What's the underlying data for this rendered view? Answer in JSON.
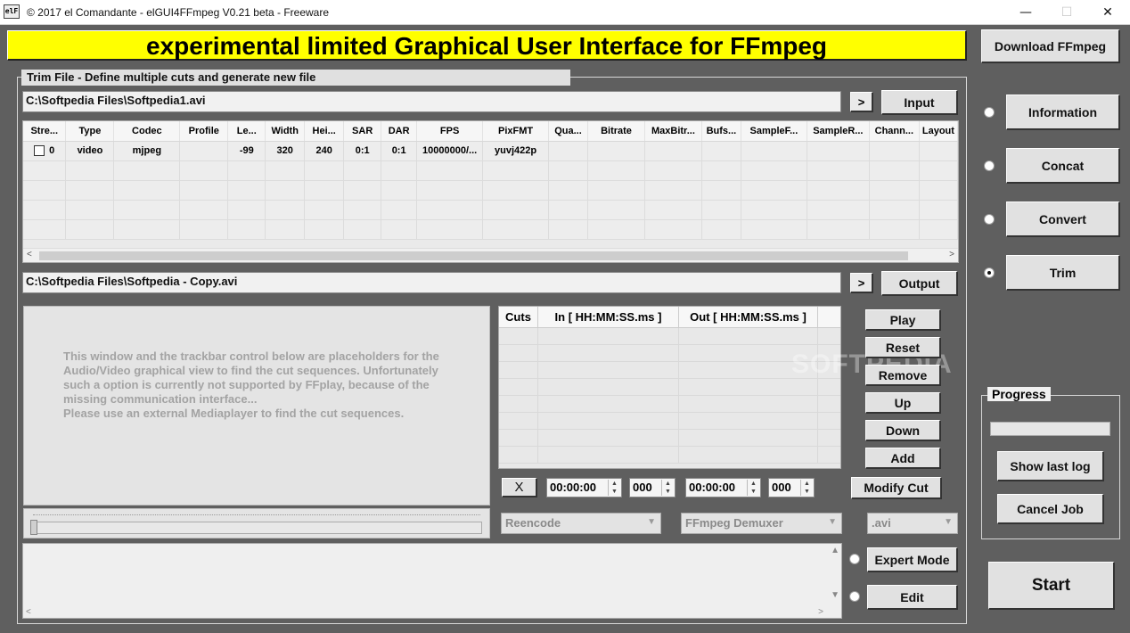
{
  "window": {
    "icon_text": "elF",
    "title": "© 2017 el Comandante - elGUI4FFmpeg V0.21 beta - Freeware",
    "controls": [
      "—",
      "☐",
      "✕"
    ]
  },
  "banner": "experimental limited Graphical User Interface for FFmpeg",
  "sidebar": {
    "download": "Download FFmpeg",
    "modes": [
      {
        "label": "Information",
        "selected": false
      },
      {
        "label": "Concat",
        "selected": false
      },
      {
        "label": "Convert",
        "selected": false
      },
      {
        "label": "Trim",
        "selected": true
      }
    ]
  },
  "trim": {
    "group_title": "Trim File - Define multiple cuts and generate new file",
    "input_path": "C:\\Softpedia Files\\Softpedia1.avi",
    "input_button": "Input",
    "arrow": ">",
    "output_path": "C:\\Softpedia Files\\Softpedia - Copy.avi",
    "output_button": "Output"
  },
  "streams": {
    "columns": [
      "Stre...",
      "Type",
      "Codec",
      "Profile",
      "Le...",
      "Width",
      "Hei...",
      "SAR",
      "DAR",
      "FPS",
      "PixFMT",
      "Qua...",
      "Bitrate",
      "MaxBitr...",
      "Bufs...",
      "SampleF...",
      "SampleR...",
      "Chann...",
      "Layout"
    ],
    "rows": [
      [
        "0",
        "video",
        "mjpeg",
        "",
        "-99",
        "320",
        "240",
        "0:1",
        "0:1",
        "10000000/...",
        "yuvj422p",
        "",
        "",
        "",
        "",
        "",
        "",
        "",
        ""
      ]
    ]
  },
  "preview_text": [
    "This window and the trackbar control below are placeholders for the",
    "Audio/Video graphical view to find the cut sequences. Unfortunately",
    "such a option is currently not supported by FFplay, because of the",
    "missing communication interface...",
    "Please use an external Mediaplayer to find the cut sequences."
  ],
  "cuts": {
    "headers": [
      "Cuts",
      "In [ HH:MM:SS.ms ]",
      "Out [ HH:MM:SS.ms ]"
    ],
    "buttons": [
      "Play",
      "Reset",
      "Remove",
      "Up",
      "Down",
      "Add"
    ],
    "clear": "X",
    "in_time": "00:00:00",
    "in_ms": "000",
    "out_time": "00:00:00",
    "out_ms": "000",
    "modify": "Modify Cut"
  },
  "options": {
    "mode": "Reencode",
    "demuxer": "FFmpeg Demuxer",
    "ext": ".avi"
  },
  "bottom": {
    "expert": "Expert Mode",
    "edit": "Edit"
  },
  "progress": {
    "title": "Progress",
    "value": 0,
    "show_log": "Show last log",
    "cancel": "Cancel Job"
  },
  "start": "Start",
  "watermark": "SOFTPEDIA"
}
